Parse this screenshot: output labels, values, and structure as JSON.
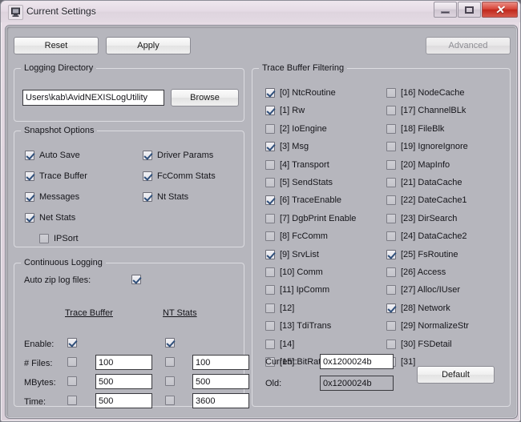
{
  "window": {
    "title": "Current Settings",
    "icon": "app-monitor-icon",
    "controls": {
      "minimize": "Minimize",
      "maximize": "Maximize",
      "close": "Close"
    },
    "colors": {
      "titlebar": "#e5dbe5",
      "client_bg": "#b6b6bd",
      "close_button": "#d9493c",
      "group_border": "#dcdce1",
      "check_mark": "#2f4f7a"
    }
  },
  "toolbar": {
    "reset_label": "Reset",
    "apply_label": "Apply",
    "advanced_label": "Advanced",
    "advanced_disabled": true
  },
  "logging_directory": {
    "title": "Logging Directory",
    "path_value": "Users\\kab\\AvidNEXISLogUtility",
    "browse_label": "Browse"
  },
  "snapshot_options": {
    "title": "Snapshot Options",
    "left": [
      {
        "label": "Auto Save",
        "checked": true
      },
      {
        "label": "Trace Buffer",
        "checked": true
      },
      {
        "label": "Messages",
        "checked": true
      },
      {
        "label": "Net Stats",
        "checked": true
      },
      {
        "label": "IPSort",
        "checked": false,
        "indent": true
      }
    ],
    "right": [
      {
        "label": "Driver Params",
        "checked": true
      },
      {
        "label": "FcComm Stats",
        "checked": true
      },
      {
        "label": "Nt Stats",
        "checked": true
      }
    ]
  },
  "continuous_logging": {
    "title": "Continuous Logging",
    "auto_zip_label": "Auto zip log files:",
    "auto_zip_checked": true,
    "column_headers": {
      "trace_buffer": "Trace Buffer",
      "nt_stats": "NT Stats"
    },
    "rows": [
      {
        "label": "Enable:",
        "trace_checked": true,
        "trace_value": null,
        "nt_checked": true,
        "nt_value": null
      },
      {
        "label": "# Files:",
        "trace_checked": false,
        "trace_value": "100",
        "nt_checked": false,
        "nt_value": "100"
      },
      {
        "label": "MBytes:",
        "trace_checked": false,
        "trace_value": "500",
        "nt_checked": false,
        "nt_value": "500"
      },
      {
        "label": "Time:",
        "trace_checked": false,
        "trace_value": "500",
        "nt_checked": false,
        "nt_value": "3600"
      }
    ]
  },
  "trace_buffer_filtering": {
    "title": "Trace Buffer Filtering",
    "left_column": [
      {
        "label": "[0] NtcRoutine",
        "checked": true
      },
      {
        "label": "[1] Rw",
        "checked": true
      },
      {
        "label": "[2] IoEngine",
        "checked": false
      },
      {
        "label": "[3] Msg",
        "checked": true
      },
      {
        "label": "[4] Transport",
        "checked": false
      },
      {
        "label": "[5] SendStats",
        "checked": false
      },
      {
        "label": "[6] TraceEnable",
        "checked": true
      },
      {
        "label": "[7] DgbPrint Enable",
        "checked": false
      },
      {
        "label": "[8] FcComm",
        "checked": false
      },
      {
        "label": "[9] SrvList",
        "checked": true
      },
      {
        "label": "[10] Comm",
        "checked": false
      },
      {
        "label": "[11] IpComm",
        "checked": false
      },
      {
        "label": "[12]",
        "checked": false
      },
      {
        "label": "[13] TdiTrans",
        "checked": false
      },
      {
        "label": "[14]",
        "checked": false
      },
      {
        "label": "[15] BitRate",
        "checked": false
      }
    ],
    "right_column": [
      {
        "label": "[16] NodeCache",
        "checked": false
      },
      {
        "label": "[17] ChannelBLk",
        "checked": false
      },
      {
        "label": "[18] FileBlk",
        "checked": false
      },
      {
        "label": "[19] IgnoreIgnore",
        "checked": false
      },
      {
        "label": "[20] MapInfo",
        "checked": false
      },
      {
        "label": "[21] DataCache",
        "checked": false
      },
      {
        "label": "[22] DateCache1",
        "checked": false
      },
      {
        "label": "[23] DirSearch",
        "checked": false
      },
      {
        "label": "[24] DataCache2",
        "checked": false
      },
      {
        "label": "[25] FsRoutine",
        "checked": true
      },
      {
        "label": "[26] Access",
        "checked": false
      },
      {
        "label": "[27] Alloc/IUser",
        "checked": false
      },
      {
        "label": "[28] Network",
        "checked": true
      },
      {
        "label": "[29] NormalizeStr",
        "checked": false
      },
      {
        "label": "[30] FSDetail",
        "checked": false
      },
      {
        "label": "[31]",
        "checked": false
      }
    ],
    "current_label": "Current:",
    "current_value": "0x1200024b",
    "old_label": "Old:",
    "old_value": "0x1200024b",
    "default_label": "Default"
  }
}
